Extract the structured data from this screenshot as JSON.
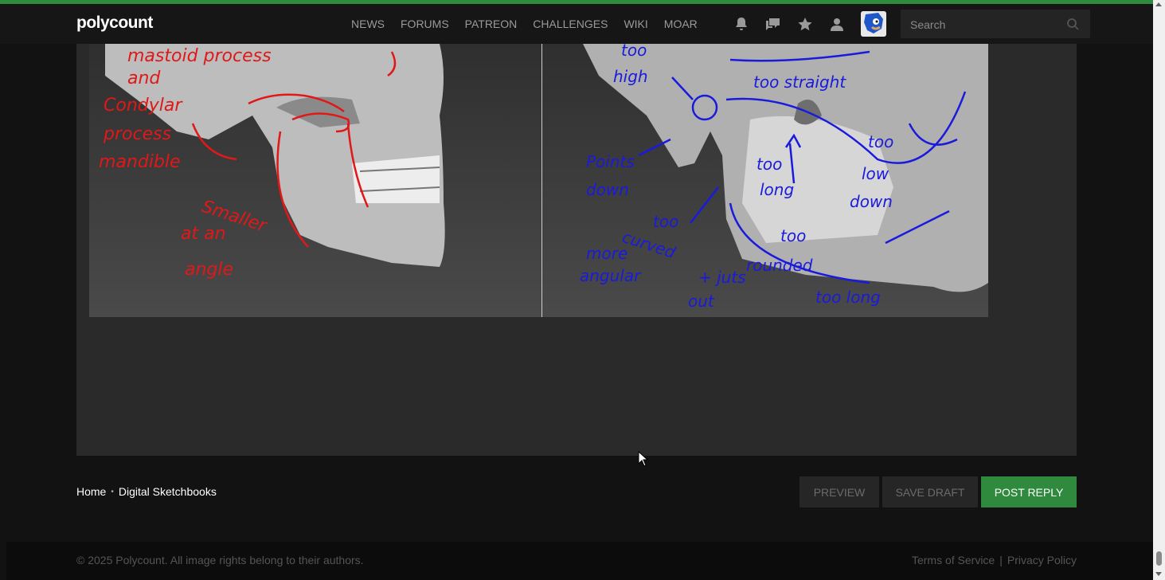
{
  "header": {
    "logo": "polycount",
    "nav": [
      "NEWS",
      "FORUMS",
      "PATREON",
      "CHALLENGES",
      "WIKI",
      "MOAR"
    ],
    "icons": [
      "bell-icon",
      "chat-icon",
      "star-icon",
      "user-icon"
    ],
    "search_placeholder": "Search"
  },
  "image": {
    "left_annotations": [
      "mastoid process",
      "and",
      "Condylar",
      "process",
      "mandible",
      "Smaller",
      "at an",
      "angle"
    ],
    "right_annotations": [
      "too",
      "high",
      "too straight",
      "Points",
      "down",
      "too",
      "long",
      "too",
      "low",
      "down",
      "too",
      "curved",
      "more",
      "angular",
      "+ juts",
      "out",
      "too",
      "rounded",
      "too long"
    ],
    "left_color": "#e01818",
    "right_color": "#1a1adc"
  },
  "footer_bar": {
    "breadcrumb": [
      "Home",
      "Digital Sketchbooks"
    ],
    "buttons": {
      "preview": "PREVIEW",
      "save_draft": "SAVE DRAFT",
      "post_reply": "POST REPLY"
    }
  },
  "footer": {
    "copyright": "© 2025 Polycount. All image rights belong to their authors.",
    "links": [
      "Terms of Service",
      "Privacy Policy"
    ],
    "separator": "|"
  },
  "colors": {
    "accent": "#2e8b3e",
    "post_button": "#2f8a3d"
  }
}
